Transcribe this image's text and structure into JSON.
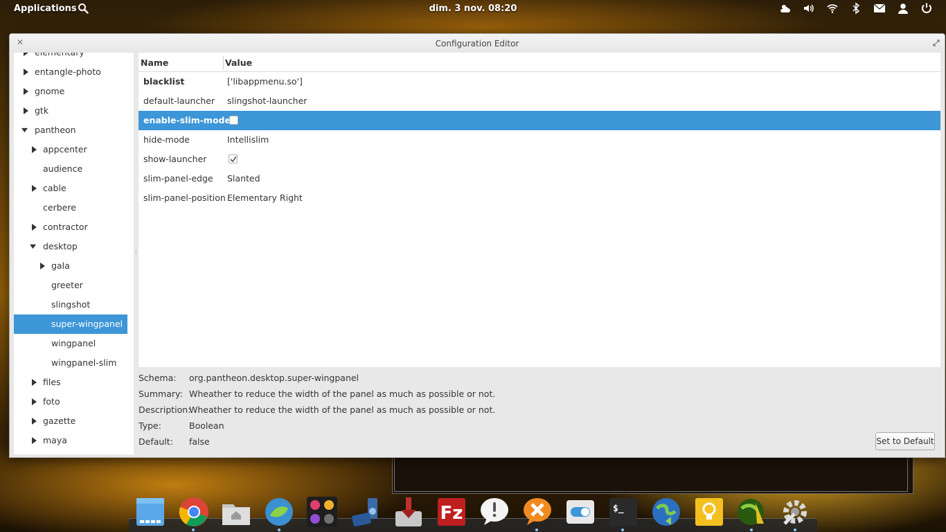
{
  "top_panel": {
    "applications_label": "Applications",
    "clock": "dim.  3 nov. 08:20",
    "tray_icons": [
      "weather-icon",
      "volume-icon",
      "wifi-icon",
      "bluetooth-icon",
      "mail-icon",
      "user-icon",
      "power-icon"
    ]
  },
  "window": {
    "title": "Configuration Editor"
  },
  "sidebar": {
    "items": [
      {
        "label": "elementary",
        "expanded": false
      },
      {
        "label": "entangle-photo",
        "expanded": false
      },
      {
        "label": "gnome",
        "expanded": false
      },
      {
        "label": "gtk",
        "expanded": false
      },
      {
        "label": "pantheon",
        "expanded": true
      },
      {
        "label": "appcenter",
        "expanded": false
      },
      {
        "label": "audience"
      },
      {
        "label": "cable",
        "expanded": false
      },
      {
        "label": "cerbere"
      },
      {
        "label": "contractor",
        "expanded": false
      },
      {
        "label": "desktop",
        "expanded": true
      },
      {
        "label": "gala",
        "expanded": false
      },
      {
        "label": "greeter"
      },
      {
        "label": "slingshot"
      },
      {
        "label": "super-wingpanel",
        "selected": true
      },
      {
        "label": "wingpanel"
      },
      {
        "label": "wingpanel-slim"
      },
      {
        "label": "files",
        "expanded": false
      },
      {
        "label": "foto",
        "expanded": false
      },
      {
        "label": "gazette",
        "expanded": false
      },
      {
        "label": "maya",
        "expanded": false
      }
    ]
  },
  "table": {
    "headers": {
      "name": "Name",
      "value": "Value"
    },
    "rows": [
      {
        "name": "blacklist",
        "value": "['libappmenu.so']"
      },
      {
        "name": "default-launcher",
        "value": "slingshot-launcher"
      },
      {
        "name": "enable-slim-mode",
        "value": "",
        "checkbox": false
      },
      {
        "name": "hide-mode",
        "value": "Intellislim"
      },
      {
        "name": "show-launcher",
        "value": "",
        "checkbox": true
      },
      {
        "name": "slim-panel-edge",
        "value": "Slanted"
      },
      {
        "name": "slim-panel-position",
        "value": "Elementary Right"
      }
    ]
  },
  "details": {
    "schema_label": "Schema:",
    "schema": "org.pantheon.desktop.super-wingpanel",
    "summary_label": "Summary:",
    "summary": "Wheather to reduce the width of the panel as much as possible or not.",
    "description_label": "Description:",
    "description": "Wheather to reduce the width of the panel as much as possible or not.",
    "type_label": "Type:",
    "type": "Boolean",
    "default_label": "Default:",
    "default": "false",
    "set_default_label": "Set to Default"
  },
  "dock": {
    "apps": [
      "files-app-icon",
      "chrome-icon",
      "home-folder-icon",
      "midori-browser-icon",
      "photo-viewer-icon",
      "audio-player-icon",
      "download-manager-icon",
      "filezilla-icon",
      "pidgin-icon",
      "crossover-icon",
      "switchboard-toggle-icon",
      "terminal-icon",
      "globe-sync-icon",
      "tips-bulb-icon",
      "shotwell-icon",
      "configuration-editor-icon"
    ]
  },
  "colors": {
    "accent": "#3c96d8",
    "window_bg": "#e8e8e8"
  }
}
